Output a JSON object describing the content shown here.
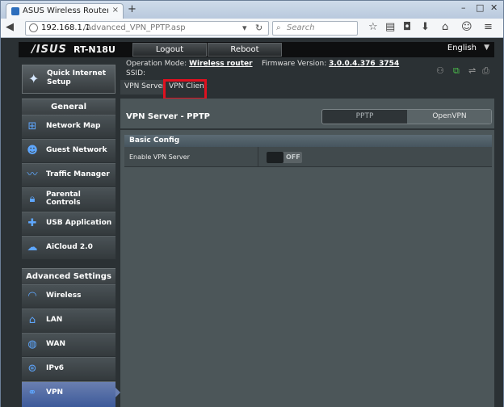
{
  "browser": {
    "tab_title": "ASUS Wireless Router RT-N...",
    "tab_close": "×",
    "new_tab": "+",
    "window_controls": {
      "minimize": "–",
      "maximize": "□",
      "close": "✕"
    },
    "url_host": "192.168.1.1",
    "url_path": "/Advanced_VPN_PPTP.asp",
    "search_placeholder": "Search",
    "icons": [
      "back-icon",
      "reload-icon",
      "search-icon",
      "star-icon",
      "reading-list-icon",
      "pocket-icon",
      "download-icon",
      "home-icon",
      "chat-icon",
      "menu-icon"
    ]
  },
  "router": {
    "brand": "/ISUS",
    "model": "RT-N18U",
    "logout_label": "Logout",
    "reboot_label": "Reboot",
    "language": "English",
    "op_mode_label": "Operation Mode:",
    "op_mode_value": "Wireless router",
    "firmware_label": "Firmware Version:",
    "firmware_value": "3.0.0.4.376_3754",
    "ssid_label": "SSID:",
    "subtabs": [
      "VPN Server",
      "VPN Client"
    ],
    "quick_setup": "Quick Internet Setup",
    "sections": {
      "general": "General",
      "advanced": "Advanced Settings"
    },
    "general_items": [
      "Network Map",
      "Guest Network",
      "Traffic Manager",
      "Parental Controls",
      "USB Application",
      "AiCloud 2.0"
    ],
    "advanced_items": [
      "Wireless",
      "LAN",
      "WAN",
      "IPv6",
      "VPN"
    ],
    "active_item": "VPN",
    "content": {
      "title": "VPN Server - PPTP",
      "protocols": [
        "PPTP",
        "OpenVPN"
      ],
      "selected_protocol": "OpenVPN",
      "basic_config": "Basic Config",
      "enable_label": "Enable VPN Server",
      "toggle_state": "OFF"
    }
  }
}
